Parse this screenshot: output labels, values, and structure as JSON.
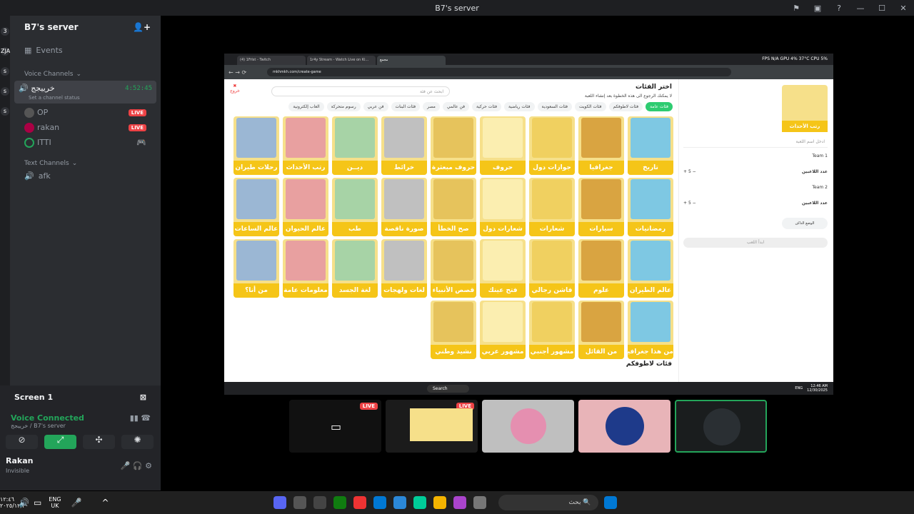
{
  "window": {
    "title": "B7's server"
  },
  "server": {
    "name": "B7's server",
    "events": "Events",
    "voice_header": "Voice Channels",
    "text_header": "Text Channels"
  },
  "voice_channel": {
    "name": "خرييجج",
    "timer": "4:52:45",
    "status": "Set a channel status",
    "users": [
      {
        "name": "OP",
        "badge": "LIVE"
      },
      {
        "name": "rakan",
        "badge": "LIVE"
      },
      {
        "name": "ITTI",
        "badge": ""
      }
    ]
  },
  "text_channels": [
    {
      "name": "afk"
    }
  ],
  "guild_letters": [
    "3",
    "ZJA",
    "s",
    "s",
    "s"
  ],
  "stream_panel": {
    "title": "Screen 1"
  },
  "voice_status": {
    "title": "Voice Connected",
    "sub": "خرييجج / B7's server"
  },
  "user": {
    "name": "Rakan",
    "status": "Invisible"
  },
  "browser": {
    "tabs": [
      "(4) 1Frlst - Twitch",
      "1r4y Stream - Watch Live on Ki...",
      "مجمع"
    ],
    "url": "mkhmkh.com/create-game",
    "stats": {
      "fps_label": "FPS",
      "fps": "N/A",
      "gpu_label": "GPU",
      "gpu": "4%",
      "temp": "37°C",
      "cpu_label": "CPU",
      "cpu": "5%"
    }
  },
  "page": {
    "heading": "اختر الفئات",
    "subheading": "لا يمكنك الرجوع الى هذه الخطوة بعد إنشاء اللعبة",
    "search_placeholder": "ابحث عن فئة",
    "back_label": "خروج",
    "chips": [
      "فئات عامة",
      "فئات لاطوفكم",
      "فئات الكويت",
      "فئات السعودية",
      "فئات رياضية",
      "فئات حركية",
      "فن عالمي",
      "مصر",
      "فئات البنات",
      "فن عربي",
      "رسوم متحركة",
      "العاب إلكترونية"
    ],
    "cards": [
      "تاريخ",
      "جغرافيا",
      "جوازات دول",
      "حروف",
      "حروف مبعثرة",
      "خرائط",
      "ديــن",
      "رتب الأحداث",
      "رحلات طيران",
      "رمضانيات",
      "سيارات",
      "شعارات",
      "شعارات دول",
      "صح الخطأ",
      "صورة ناقصة",
      "طب",
      "عالم الحيوان",
      "عالم الساعات",
      "عالم الطيران",
      "علوم",
      "فاشن رجالي",
      "فتح عينك",
      "قصص الأنبياء",
      "لغات ولهجات",
      "لغة الجسد",
      "معلومات عامة",
      "من أنا؟",
      "من هذا جغرافيا؟",
      "من القائل",
      "مشهور أجنبي",
      "مشهور عربي",
      "نشيد وطني"
    ],
    "section_title": "فئات لاطوفكم",
    "side": {
      "card_label": "رتب الأحداث",
      "name_placeholder": "ادخل اسم اللعبة",
      "team1": "Team 1",
      "team2": "Team 2",
      "players_label": "عدد اللاعبين",
      "players1": "5",
      "players2": "5",
      "toggle_a": "الوضع الداكن",
      "start": "ابدأ اللعب"
    }
  },
  "inner_taskbar": {
    "search": "Search",
    "lang": "ENG",
    "time": "12:46 AM",
    "date": "12/30/2025"
  },
  "thumbs": [
    {
      "badge": "LIVE"
    },
    {
      "badge": "LIVE"
    },
    {
      "badge": ""
    },
    {
      "badge": ""
    },
    {
      "badge": ""
    }
  ],
  "taskbar": {
    "lang": "ENG",
    "region": "UK",
    "search_placeholder": "بحث",
    "time": "١٢:٤٦",
    "date": "٢٠٢٥/١٢/٣٠"
  },
  "colors": {
    "accent_green": "#23a55a",
    "live_red": "#ed4245",
    "card_yellow": "#f5c518"
  }
}
